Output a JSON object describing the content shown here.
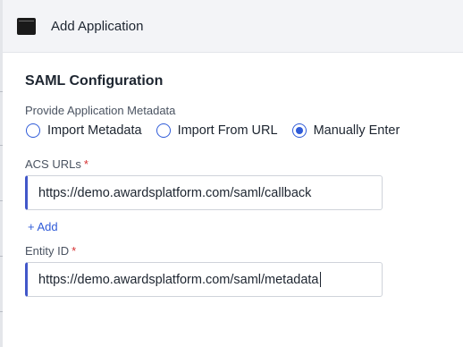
{
  "header": {
    "title": "Add Application",
    "icon": "application-window-icon"
  },
  "saml": {
    "section_title": "SAML Configuration",
    "metadata_label": "Provide Application Metadata",
    "options": [
      {
        "label": "Import Metadata",
        "selected": false
      },
      {
        "label": "Import From URL",
        "selected": false
      },
      {
        "label": "Manually Enter",
        "selected": true
      }
    ],
    "acs": {
      "label": "ACS URLs",
      "required_mark": "*",
      "value": "https://demo.awardsplatform.com/saml/callback",
      "add_label": "+ Add"
    },
    "entity": {
      "label": "Entity ID",
      "required_mark": "*",
      "value": "https://demo.awardsplatform.com/saml/metadata"
    }
  },
  "colors": {
    "accent": "#2f5bd8",
    "required": "#d63031",
    "input_focus_border": "#4257c9"
  }
}
